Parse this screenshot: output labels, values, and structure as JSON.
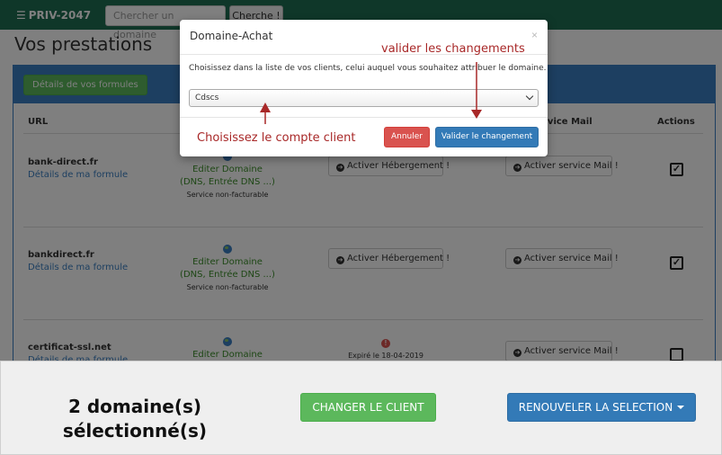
{
  "topbar": {
    "brand": "PRIV-2047",
    "search_placeholder": "Chercher un domaine",
    "search_button": "Cherche !"
  },
  "page": {
    "title": "Vos prestations"
  },
  "panel": {
    "formules_button": "Détails de vos formules"
  },
  "table": {
    "headers": {
      "url": "URL",
      "mail": "rvice Mail",
      "actions": "Actions"
    },
    "rows": [
      {
        "domain": "bank-direct.fr",
        "link": "Détails de ma formule",
        "edit": "Editer Domaine",
        "dns": "(DNS, Entrée DNS ...)",
        "status": "Service non-facturable",
        "hosting_button": "Activer Hébergement !",
        "mail_button": "Activer service Mail !",
        "checked": true
      },
      {
        "domain": "bankdirect.fr",
        "link": "Détails de ma formule",
        "edit": "Editer Domaine",
        "dns": "(DNS, Entrée DNS ...)",
        "status": "Service non-facturable",
        "hosting_button": "Activer Hébergement !",
        "mail_button": "Activer service Mail !",
        "checked": true
      },
      {
        "domain": "certificat-ssl.net",
        "link": "Détails de ma formule",
        "edit": "Editer Domaine",
        "expired": "Expiré le 18-04-2019",
        "mail_button": "Activer service Mail !",
        "checked": false
      }
    ]
  },
  "bottombar": {
    "selected_line1": "2 domaine(s)",
    "selected_line2": "sélectionné(s)",
    "change_client_button": "CHANGER LE CLIENT",
    "renew_button": "RENOUVELER LA SELECTION"
  },
  "modal": {
    "title": "Domaine-Achat",
    "close": "×",
    "instruction": "Choisissez dans la liste de vos clients, celui auquel vous souhaitez attribuer le domaine.",
    "selected_client": "Cdscs",
    "cancel_button": "Annuler",
    "validate_button": "Valider le changement"
  },
  "annotations": {
    "validate": "valider les changements",
    "choose": "Choisissez le compte client"
  },
  "colors": {
    "topbar": "#1f6e53",
    "primary": "#337ab7",
    "success": "#5cb85c",
    "danger": "#d9534f",
    "annotation": "#a82828"
  }
}
